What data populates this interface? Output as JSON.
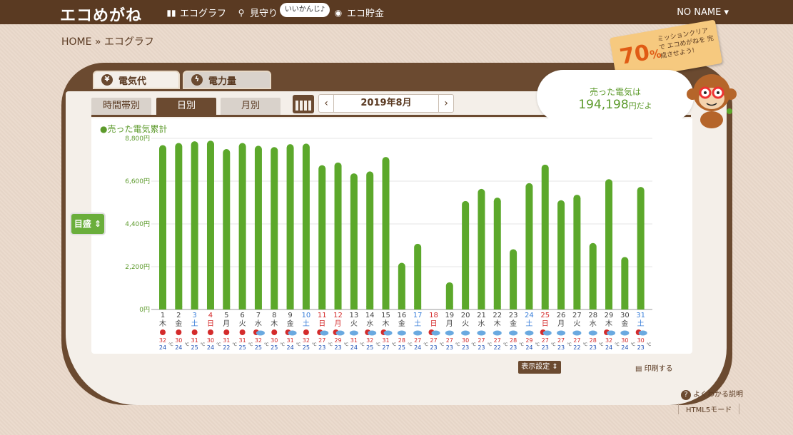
{
  "topbar": {
    "logo": "エコめがね",
    "nav": [
      {
        "label": "エコグラフ",
        "icon": "bar-chart-icon"
      },
      {
        "label": "見守り",
        "icon": "magnifier-icon"
      },
      {
        "label": "エコ貯金",
        "icon": "coin-icon"
      }
    ],
    "bubble": "いいかんじ♪",
    "user": "NO NAME ▾"
  },
  "breadcrumb": "HOME » エコグラフ",
  "mission": {
    "percent": "70",
    "unit": "%",
    "text": "ミッションクリアで エコめがねを 完成させよう!"
  },
  "tabs": [
    {
      "label": "電気代",
      "icon": "yen-icon"
    },
    {
      "label": "電力量",
      "icon": "lightning-icon"
    }
  ],
  "subtabs": [
    "時間帯別",
    "日別",
    "月別"
  ],
  "active_subtab": "日別",
  "date_nav": {
    "prev": "‹",
    "label": "2019年8月",
    "next": "›"
  },
  "speech": {
    "line1": "売った電気は",
    "value": "194,198",
    "unit": "円だよ"
  },
  "goal_button": "目盛 ⇕",
  "footer": {
    "display_settings": "表示設定 ⇕",
    "print": "印刷する",
    "help": "よくわかる説明",
    "html5": "HTML5モード"
  },
  "colors": {
    "bar": "#5ca82b",
    "brown": "#6b4a30",
    "weekday": "#444444",
    "saturday": "#3b7fd9",
    "holiday": "#d42b2b"
  },
  "chart_data": {
    "type": "bar",
    "title": "●売った電気累計",
    "ylim": [
      0,
      8800
    ],
    "yticks": [
      "8,800円",
      "6,600円",
      "4,400円",
      "2,200円",
      "0円"
    ],
    "days": [
      "1",
      "2",
      "3",
      "4",
      "5",
      "6",
      "7",
      "8",
      "9",
      "10",
      "11",
      "12",
      "13",
      "14",
      "15",
      "16",
      "17",
      "18",
      "19",
      "20",
      "21",
      "22",
      "23",
      "24",
      "25",
      "26",
      "27",
      "28",
      "29",
      "30",
      "31"
    ],
    "weekday": [
      "木",
      "金",
      "土",
      "日",
      "月",
      "火",
      "水",
      "木",
      "金",
      "土",
      "日",
      "月",
      "火",
      "水",
      "木",
      "金",
      "土",
      "日",
      "月",
      "火",
      "水",
      "木",
      "金",
      "土",
      "日",
      "月",
      "火",
      "水",
      "木",
      "金",
      "土"
    ],
    "day_type": [
      "w",
      "w",
      "s",
      "h",
      "w",
      "w",
      "w",
      "w",
      "w",
      "s",
      "h",
      "h",
      "w",
      "w",
      "w",
      "w",
      "s",
      "h",
      "w",
      "w",
      "w",
      "w",
      "w",
      "s",
      "h",
      "w",
      "w",
      "w",
      "w",
      "w",
      "s"
    ],
    "values": [
      8450,
      8560,
      8650,
      8680,
      8250,
      8560,
      8420,
      8350,
      8500,
      8530,
      7420,
      7560,
      7000,
      7100,
      7840,
      2400,
      3380,
      0,
      1400,
      5580,
      6200,
      5750,
      3100,
      6500,
      7450,
      5620,
      5900,
      3420,
      6700,
      2700,
      6300
    ],
    "weather": [
      "sun",
      "sun",
      "sun",
      "sun",
      "sun",
      "sun",
      "sunrain",
      "sun",
      "sunrain",
      "sun",
      "suncloud",
      "suncloud",
      "cloud",
      "sunrain",
      "suncloud",
      "cloud",
      "cloud",
      "sunrain",
      "cloud",
      "cloud",
      "cloud",
      "cloud",
      "cloud",
      "cloud",
      "suncloud",
      "cloud",
      "cloud",
      "rain",
      "suncloud",
      "cloud",
      "suncloud"
    ],
    "temp_high": [
      "32",
      "30",
      "31",
      "30",
      "31",
      "31",
      "32",
      "30",
      "31",
      "32",
      "27",
      "29",
      "31",
      "32",
      "31",
      "28",
      "27",
      "27",
      "27",
      "30",
      "27",
      "27",
      "28",
      "29",
      "27",
      "27",
      "27",
      "28",
      "32",
      "30",
      "30"
    ],
    "temp_low": [
      "24",
      "24",
      "25",
      "24",
      "22",
      "25",
      "25",
      "25",
      "24",
      "25",
      "23",
      "23",
      "24",
      "25",
      "27",
      "25",
      "24",
      "23",
      "23",
      "23",
      "23",
      "22",
      "23",
      "24",
      "23",
      "23",
      "22",
      "23",
      "24",
      "24",
      "23"
    ],
    "temp_unit": "℃"
  }
}
